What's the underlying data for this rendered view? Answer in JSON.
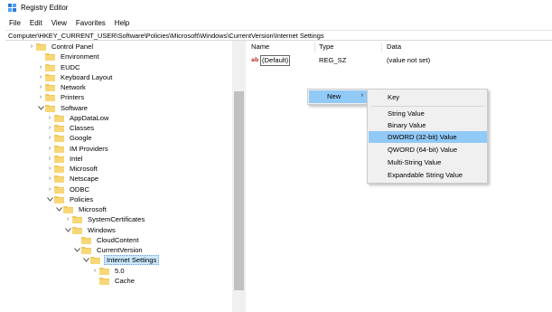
{
  "window": {
    "title": "Registry Editor"
  },
  "menubar": [
    "File",
    "Edit",
    "View",
    "Favorites",
    "Help"
  ],
  "address": "Computer\\HKEY_CURRENT_USER\\Software\\Policies\\Microsoft\\Windows\\CurrentVersion\\Internet Settings",
  "tree": [
    {
      "label": "Control Panel",
      "expander": "collapsed"
    },
    {
      "label": "Environment",
      "expander": "none"
    },
    {
      "label": "EUDC",
      "expander": "collapsed"
    },
    {
      "label": "Keyboard Layout",
      "expander": "collapsed"
    },
    {
      "label": "Network",
      "expander": "collapsed"
    },
    {
      "label": "Printers",
      "expander": "collapsed"
    },
    {
      "label": "Software",
      "expander": "expanded"
    },
    {
      "label": "AppDataLow",
      "expander": "collapsed"
    },
    {
      "label": "Classes",
      "expander": "collapsed"
    },
    {
      "label": "Google",
      "expander": "collapsed"
    },
    {
      "label": "IM Providers",
      "expander": "collapsed"
    },
    {
      "label": "Intel",
      "expander": "collapsed"
    },
    {
      "label": "Microsoft",
      "expander": "collapsed"
    },
    {
      "label": "Netscape",
      "expander": "collapsed"
    },
    {
      "label": "ODBC",
      "expander": "collapsed"
    },
    {
      "label": "Policies",
      "expander": "expanded"
    },
    {
      "label": "Microsoft",
      "expander": "expanded"
    },
    {
      "label": "SystemCertificates",
      "expander": "collapsed"
    },
    {
      "label": "Windows",
      "expander": "expanded"
    },
    {
      "label": "CloudContent",
      "expander": "none"
    },
    {
      "label": "CurrentVersion",
      "expander": "expanded"
    },
    {
      "label": "Internet Settings",
      "expander": "expanded",
      "selected": true
    },
    {
      "label": "5.0",
      "expander": "collapsed"
    },
    {
      "label": "Cache",
      "expander": "none"
    }
  ],
  "columns": {
    "name": "Name",
    "type": "Type",
    "data": "Data"
  },
  "values": [
    {
      "name": "(Default)",
      "type": "REG_SZ",
      "data": "(value not set)",
      "icon": "ab"
    }
  ],
  "context_menu": {
    "item": "New",
    "arrow": "›"
  },
  "submenu": {
    "items": [
      "Key",
      "String Value",
      "Binary Value",
      "DWORD (32-bit) Value",
      "QWORD (64-bit) Value",
      "Multi-String Value",
      "Expandable String Value"
    ],
    "highlighted": "DWORD (32-bit) Value"
  },
  "colors": {
    "folder": "#f0c85a",
    "highlight": "#91c9f7",
    "selected": "#cce8ff"
  }
}
